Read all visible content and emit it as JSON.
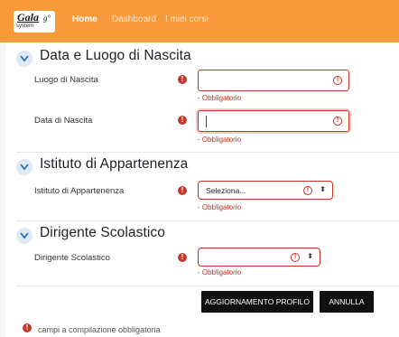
{
  "brand": {
    "logo_word": "Gala",
    "logo_sup": "g°",
    "logo_sub": "system"
  },
  "nav": {
    "home": "Home",
    "dashboard": "Dashboard",
    "courses": "I miei corsi"
  },
  "sections": {
    "birth": {
      "title": "Data e Luogo di Nascita"
    },
    "institute": {
      "title": "Istituto di Appartenenza"
    },
    "principal": {
      "title": "Dirigente Scolastico"
    }
  },
  "fields": {
    "birthplace": {
      "label": "Luogo di Nascita",
      "value": "",
      "error": "- Obbligatorio"
    },
    "birthdate": {
      "label": "Data di Nascita",
      "value": "",
      "error": "- Obbligatorio"
    },
    "institute": {
      "label": "Istituto di Appartenenza",
      "selected": "Seleziona...",
      "error": "- Obbligatorio"
    },
    "principal": {
      "label": "Dirigente Scolastico",
      "selected": "",
      "error": "- Obbligatorio"
    }
  },
  "icons": {
    "required": "exclamation-circle-icon",
    "error": "error-circle-icon",
    "chevron": "chevron-down-icon",
    "sort": "up-down-icon"
  },
  "glyphs": {
    "required": "!",
    "error": "!",
    "updown": "⬍"
  },
  "buttons": {
    "update": "AGGIORNAMENTO PROFILO",
    "cancel": "ANNULLA"
  },
  "footer": {
    "required_note": "campi a compilazione obbligatoria"
  },
  "colors": {
    "navbar": "#f89a3c",
    "error": "#ca3120",
    "button": "#111111"
  }
}
